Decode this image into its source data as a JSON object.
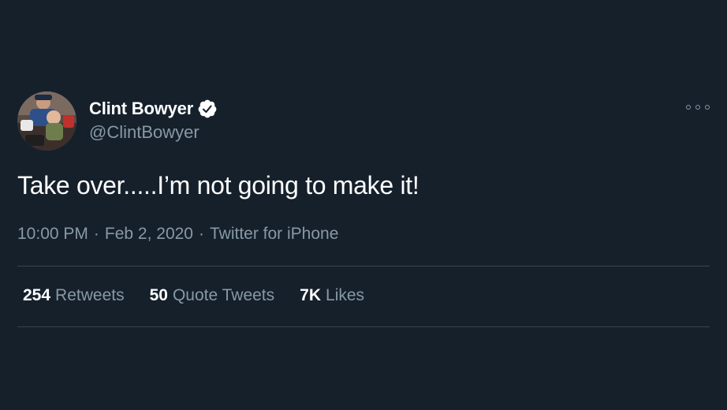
{
  "author": {
    "display_name": "Clint Bowyer",
    "handle": "@ClintBowyer",
    "verified": true
  },
  "tweet": {
    "text": "Take over.....I’m not going to make it!",
    "time": "10:00 PM",
    "date": "Feb 2, 2020",
    "source": "Twitter for iPhone",
    "separator": "·"
  },
  "stats": [
    {
      "count": "254",
      "label": "Retweets"
    },
    {
      "count": "50",
      "label": "Quote Tweets"
    },
    {
      "count": "7K",
      "label": "Likes"
    }
  ],
  "icons": {
    "verified": "verified-badge-icon",
    "more": "more-options-icon"
  },
  "colors": {
    "background": "#15202b",
    "primary_text": "#ffffff",
    "secondary_text": "#8899a6",
    "divider": "#38444d"
  }
}
